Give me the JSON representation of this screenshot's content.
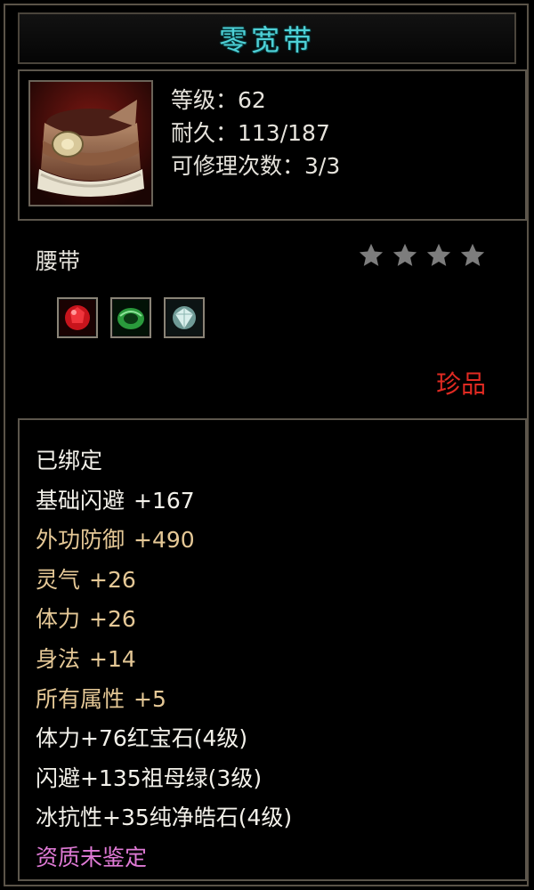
{
  "item": {
    "name": "零宽带",
    "stats": [
      {
        "label": "等级：62"
      },
      {
        "label": "耐久：113/187"
      },
      {
        "label": "可修理次数：3/3"
      }
    ],
    "type": "腰带",
    "rarity": "珍品",
    "stars": 4,
    "gems": [
      {
        "icon": "ruby-gem-icon"
      },
      {
        "icon": "emerald-gem-icon"
      },
      {
        "icon": "diamond-gem-icon"
      }
    ]
  },
  "details": {
    "bound": "已绑定",
    "base_attrs": [
      {
        "name": "基础闪避",
        "value": "+167"
      },
      {
        "name": "外功防御",
        "value": "+490"
      },
      {
        "name": "灵气",
        "value": "+26"
      },
      {
        "name": "体力",
        "value": "+26"
      },
      {
        "name": "身法",
        "value": "+14"
      },
      {
        "name": "所有属性",
        "value": "+5"
      }
    ],
    "gem_bonuses": [
      "体力+76红宝石(4级)",
      "闪避+135祖母绿(3级)",
      "冰抗性+35纯净皓石(4级)"
    ],
    "quality": "资质未鉴定"
  },
  "colors": {
    "title": "#4fd0d6",
    "rarity": "#e02a22",
    "attr_gold": "#e5c896",
    "quality_pink": "#e07ad6",
    "star_gray": "#7d7d7d"
  }
}
